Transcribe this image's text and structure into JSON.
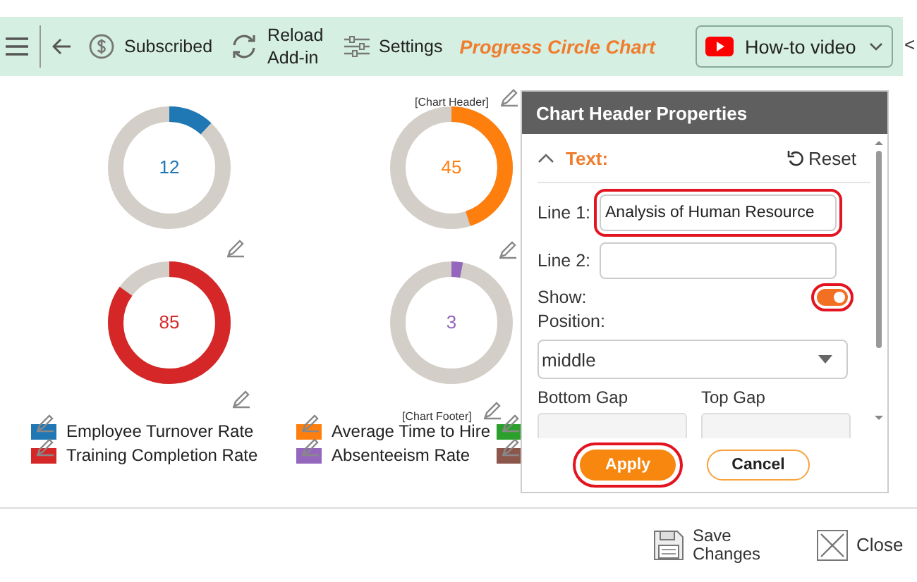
{
  "toolbar": {
    "items": [
      {
        "kind": "menu"
      },
      {
        "kind": "back"
      },
      {
        "kind": "subscribed",
        "label": "Subscribed"
      },
      {
        "kind": "reload",
        "label": "Reload Add-in"
      },
      {
        "kind": "settings",
        "label": "Settings"
      }
    ],
    "title": "Progress Circle Chart",
    "video_button": "How-to video",
    "collapse_glyph": "<"
  },
  "chart": {
    "header_placeholder": "[Chart Header]",
    "footer_placeholder": "[Chart Footer]",
    "circles": [
      {
        "value": "12",
        "level": 0.12,
        "color": "#1f77b4"
      },
      {
        "value": "45",
        "level": 0.45,
        "color": "#ff7f0e"
      },
      {
        "value": "85",
        "level": 0.85,
        "color": "#d62728"
      },
      {
        "value": "3",
        "level": 0.03,
        "color": "#9467bd"
      }
    ],
    "legend": [
      {
        "label": "Employee Turnover Rate",
        "color": "#1f77b4"
      },
      {
        "label": "Average Time to Hire",
        "color": "#ff7f0e"
      },
      {
        "color": "#2ca02c"
      },
      {
        "label": "Training Completion Rate",
        "color": "#d62728"
      },
      {
        "label": "Absenteeism Rate",
        "color": "#9467bd"
      },
      {
        "color": "#8c564b"
      }
    ]
  },
  "panel": {
    "title": "Chart Header Properties",
    "section": {
      "label": "Text:",
      "expanded": true
    },
    "reset": "Reset",
    "fields": [
      {
        "kind": "text",
        "label": "Line 1:",
        "value": "Analysis of Human Resource",
        "highlighted": true
      },
      {
        "kind": "text",
        "label": "Line 2:",
        "highlighted": false
      },
      {
        "kind": "toggle",
        "label": "Show:",
        "on": true,
        "highlighted": true
      },
      {
        "kind": "select",
        "label": "Position:",
        "value": "middle"
      },
      {
        "kind": "pair",
        "labels": [
          "Bottom Gap",
          "Top Gap"
        ]
      }
    ],
    "buttons": [
      {
        "kind": "primary",
        "label": "Apply",
        "highlighted": true
      },
      {
        "kind": "secondary",
        "label": "Cancel",
        "highlighted": false
      }
    ]
  },
  "bottom_bar": {
    "save": "Save Changes",
    "close": "Close"
  }
}
